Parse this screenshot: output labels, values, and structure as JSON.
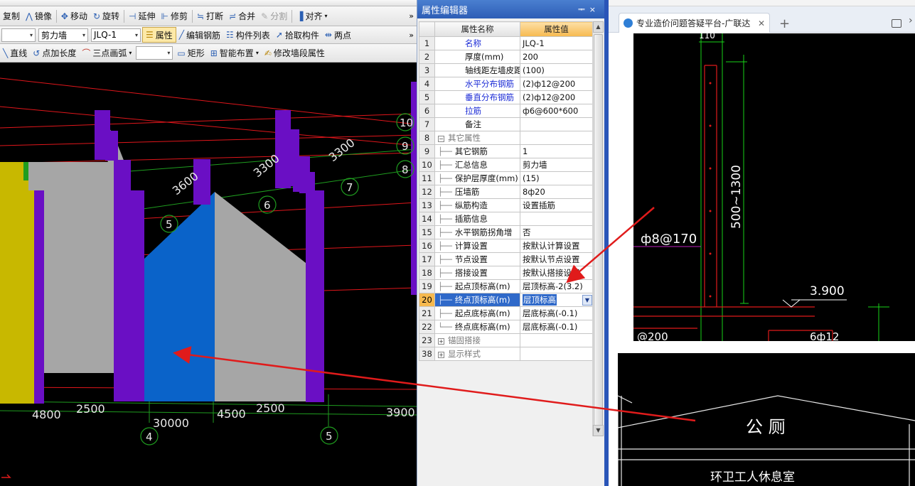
{
  "cad": {
    "toolbar1": {
      "copy": "复制",
      "mirror": "镜像",
      "move": "移动",
      "rotate": "旋转",
      "extend": "延伸",
      "trim": "修剪",
      "break": "打断",
      "merge": "合并",
      "split": "分割",
      "align": "对齐"
    },
    "toolbar2": {
      "type_value": "剪力墙",
      "name_value": "JLQ-1",
      "properties": "属性",
      "edit_rebar": "编辑钢筋",
      "component_list": "构件列表",
      "pick_component": "拾取构件",
      "two_points": "两点"
    },
    "toolbar3": {
      "line": "直线",
      "point_length": "点加长度",
      "three_point_arc": "三点画弧",
      "rectangle": "矩形",
      "smart_layout": "智能布置",
      "modify_wall_segment": "修改墙段属性"
    },
    "viewport": {
      "dims_diag": [
        "3600",
        "3300",
        "3300"
      ],
      "axis_numbers": [
        "10",
        "9",
        "8",
        "7",
        "6",
        "5"
      ],
      "bottom_dims": [
        "4800",
        "2500",
        "30000",
        "4500",
        "2500",
        "3900"
      ],
      "bottom_axes": [
        "4",
        "5"
      ]
    }
  },
  "prop_editor": {
    "title": "属性编辑器",
    "col_name": "属性名称",
    "col_value": "属性值",
    "rows": [
      {
        "num": "1",
        "name": "名称",
        "value": "JLQ-1"
      },
      {
        "num": "2",
        "name": "厚度(mm)",
        "value": "200"
      },
      {
        "num": "3",
        "name": "轴线距左墙皮距离",
        "value": "(100)"
      },
      {
        "num": "4",
        "name": "水平分布钢筋",
        "value": "(2)ф12@200"
      },
      {
        "num": "5",
        "name": "垂直分布钢筋",
        "value": "(2)ф12@200"
      },
      {
        "num": "6",
        "name": "拉筋",
        "value": "ф6@600*600"
      },
      {
        "num": "7",
        "name": "备注",
        "value": ""
      },
      {
        "num": "8",
        "name": "其它属性",
        "value": ""
      },
      {
        "num": "9",
        "name": "其它钢筋",
        "value": "1"
      },
      {
        "num": "10",
        "name": "汇总信息",
        "value": "剪力墙"
      },
      {
        "num": "11",
        "name": "保护层厚度(mm)",
        "value": "(15)"
      },
      {
        "num": "12",
        "name": "压墙筋",
        "value": "8ф20"
      },
      {
        "num": "13",
        "name": "纵筋构造",
        "value": "设置插筋"
      },
      {
        "num": "14",
        "name": "插筋信息",
        "value": ""
      },
      {
        "num": "15",
        "name": "水平钢筋拐角增",
        "value": "否"
      },
      {
        "num": "16",
        "name": "计算设置",
        "value": "按默认计算设置"
      },
      {
        "num": "17",
        "name": "节点设置",
        "value": "按默认节点设置"
      },
      {
        "num": "18",
        "name": "搭接设置",
        "value": "按默认搭接设置"
      },
      {
        "num": "19",
        "name": "起点顶标高(m)",
        "value": "层顶标高-2(3.2)"
      },
      {
        "num": "20",
        "name": "终点顶标高(m)",
        "value": "层顶标高"
      },
      {
        "num": "21",
        "name": "起点底标高(m)",
        "value": "层底标高(-0.1)"
      },
      {
        "num": "22",
        "name": "终点底标高(m)",
        "value": "层底标高(-0.1)"
      },
      {
        "num": "23",
        "name": "锚固搭接",
        "value": ""
      },
      {
        "num": "38",
        "name": "显示样式",
        "value": ""
      }
    ]
  },
  "browser": {
    "tab_title": "专业造价问题答疑平台-广联达",
    "drawing1": {
      "rebar_label": "ф8@170",
      "height_label": "500~1300",
      "elevation": "3.900",
      "top_dim": "110",
      "bottom_left": "@200",
      "bottom_right": "6ф12"
    },
    "drawing2": {
      "title": "公 厕",
      "subtitle": "环卫工人休息室"
    }
  },
  "colors": {
    "wall_purple": "#6a0fc4",
    "wall_gray": "#a6a6a6",
    "wall_blue": "#0a63c9",
    "wall_yellow": "#c8b800",
    "grid_red": "#e0161b",
    "grid_green": "#1f9d1f",
    "arrow_red": "#e01b1b"
  }
}
